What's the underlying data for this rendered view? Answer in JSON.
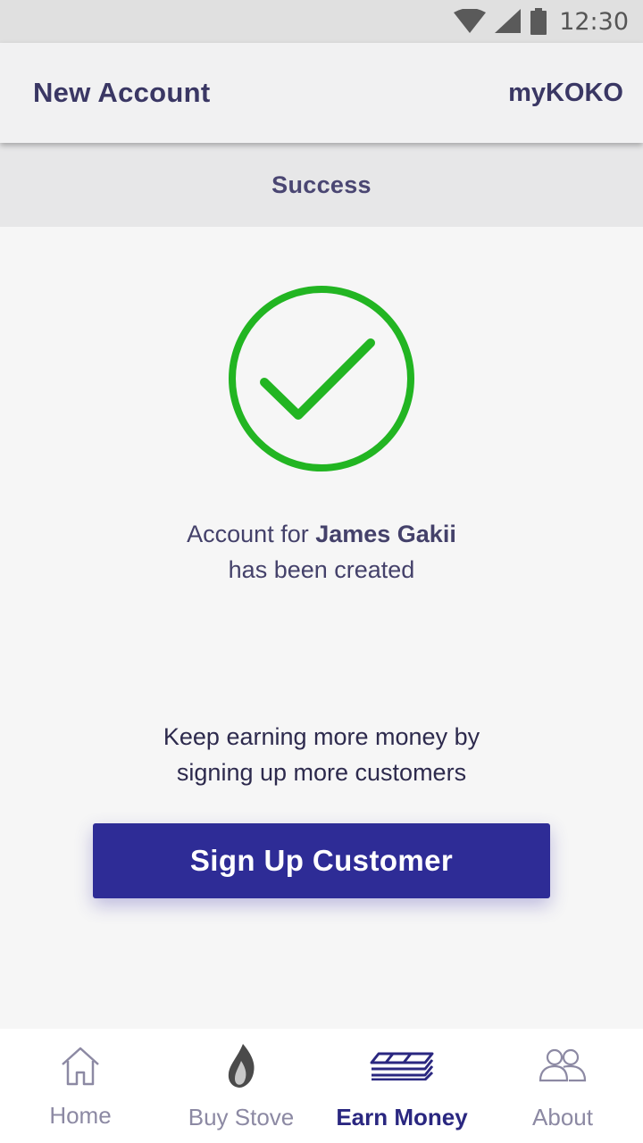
{
  "status_bar": {
    "time": "12:30"
  },
  "app_bar": {
    "title": "New Account",
    "brand": "myKOKO"
  },
  "subheader": {
    "title": "Success"
  },
  "message": {
    "account_prefix": "Account for ",
    "account_name": "James Gakii",
    "account_suffix": "has been created",
    "encourage_line1": "Keep earning more money by",
    "encourage_line2": "signing up more customers"
  },
  "actions": {
    "signup_label": "Sign Up Customer"
  },
  "bottom_nav": {
    "items": [
      {
        "label": "Home",
        "icon": "home-icon",
        "active": false
      },
      {
        "label": "Buy Stove",
        "icon": "flame-icon",
        "active": false
      },
      {
        "label": "Earn Money",
        "icon": "money-stack-icon",
        "active": true
      },
      {
        "label": "About",
        "icon": "people-icon",
        "active": false
      }
    ]
  },
  "colors": {
    "accent": "#2e2c96",
    "success": "#22b522",
    "text": "#3d3a63",
    "nav_inactive": "#8c89a3"
  }
}
